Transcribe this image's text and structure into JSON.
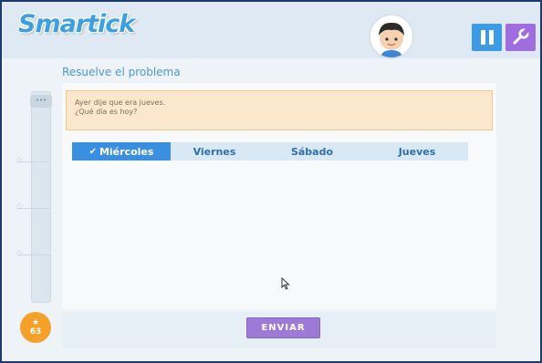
{
  "header": {
    "logo_text": "Smartick",
    "avatar_icon": "boy-avatar-icon",
    "pause_icon": "pause-icon",
    "tools_icon": "wrench-icon",
    "colors": {
      "pause": "#3d9be6",
      "tools": "#a06de0",
      "logo": "#3ca0de"
    }
  },
  "sidebar": {
    "top_label": "•••",
    "star_count": "63",
    "star_icon": "star-icon"
  },
  "main": {
    "title": "Resuelve el problema",
    "problem": {
      "line1": "Ayer dije que era jueves.",
      "line2": "¿Qué día es hoy?"
    },
    "options": [
      {
        "label": "Miércoles",
        "selected": true
      },
      {
        "label": "Viernes",
        "selected": false
      },
      {
        "label": "Sábado",
        "selected": false
      },
      {
        "label": "Jueves",
        "selected": false
      }
    ],
    "submit_label": "ENVIAR"
  }
}
